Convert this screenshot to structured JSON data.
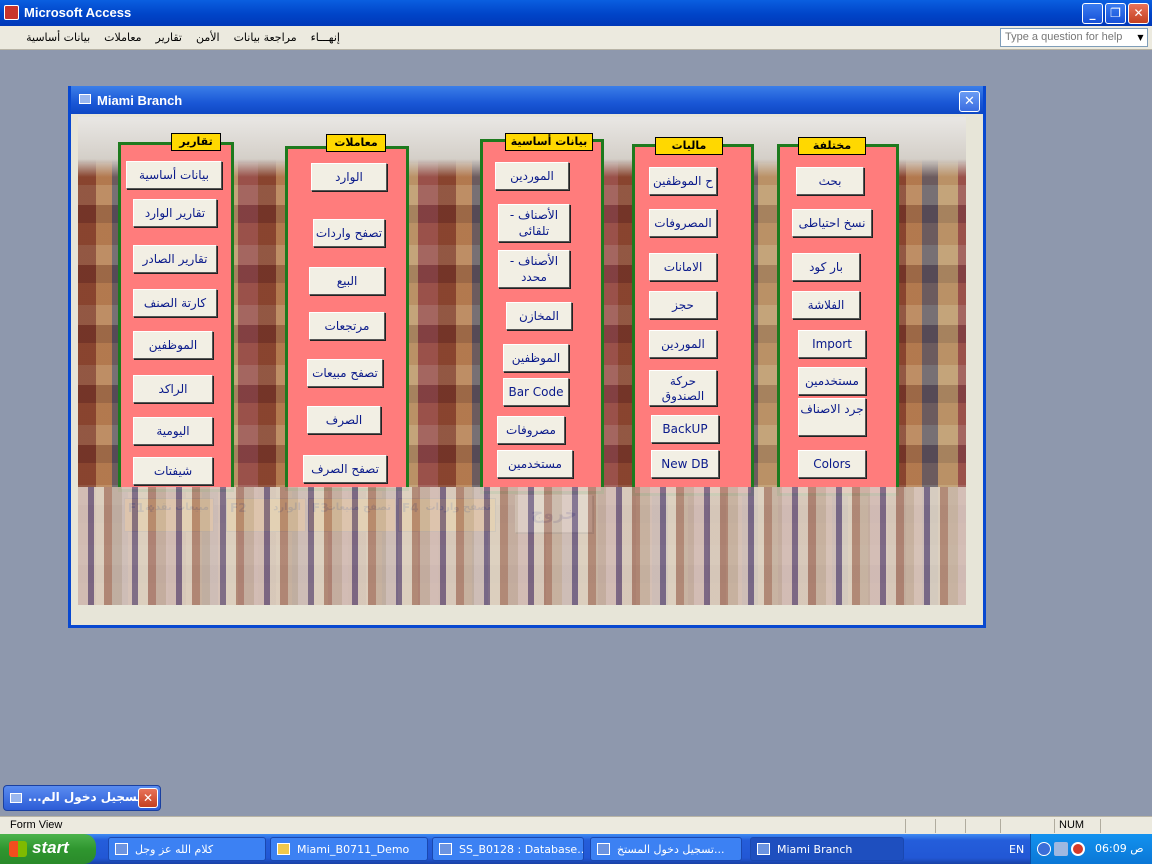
{
  "app": {
    "title": "Microsoft Access"
  },
  "menu": [
    "إنهـــاء",
    "مراجعة بيانات",
    "الأمن",
    "تقارير",
    "معاملات",
    "بيانات أساسية"
  ],
  "help_placeholder": "Type a question for help",
  "form": {
    "title": "Miami Branch",
    "panels": {
      "reports": {
        "header": "تقارير",
        "buttons": [
          "بيانات أساسية",
          "تقارير الوارد",
          "تقارير الصادر",
          "كارتة الصنف",
          "الموظفين",
          "الراكد",
          "اليومية",
          "شيفتات"
        ]
      },
      "transactions": {
        "header": "معاملات",
        "buttons": [
          "الوارد",
          "تصفح واردات",
          "البيع",
          "مرتجعات",
          "تصفح مبيعات",
          "الصرف",
          "تصفح الصرف"
        ]
      },
      "master": {
        "header": "بيانات أساسية",
        "buttons": [
          "الموردين",
          "الأصناف - تلقائى",
          "الأصناف - محدد",
          "المخازن",
          "الموظفين",
          "Bar Code",
          "مصروفات",
          "مستخدمين"
        ]
      },
      "finance": {
        "header": "ماليات",
        "buttons": [
          "ح الموظفين",
          "المصروفات",
          "الامانات",
          "حجز",
          "الموردين",
          "حركة الصندوق",
          "BackUP",
          "New DB"
        ]
      },
      "misc": {
        "header": "مختلفة",
        "buttons": [
          "بحث",
          "نسخ احتياطى",
          "بار كود",
          "الفلاشة",
          "Import",
          "مستخدمين",
          "جرد الاصناف",
          "Colors"
        ]
      }
    },
    "fkeys": [
      {
        "key": "F1 :",
        "label": "مبيعات نقدية"
      },
      {
        "key": "F2",
        "label": "الوارد"
      },
      {
        "key": "F3",
        "label": "تصفح مبيعات"
      },
      {
        "key": "F4",
        "label": "تصفح واردات"
      }
    ],
    "exit_label": "خروج"
  },
  "minimized": {
    "title": "تسجيل دخول الم..."
  },
  "status": {
    "text": "Form View",
    "num": "NUM"
  },
  "taskbar": {
    "start": "start",
    "tasks": [
      "كلام الله عز وجل",
      "Miami_B0711_Demo",
      "SS_B0128 : Database...",
      "تسجيل دخول المستخ...",
      "Miami Branch"
    ],
    "lang": "EN",
    "clock": "06:09 ص"
  },
  "colors": {
    "panel": "#ff7c7c",
    "panel_border": "#1e7a1e",
    "header": "#ffd800",
    "fkey": "#ffa500"
  }
}
